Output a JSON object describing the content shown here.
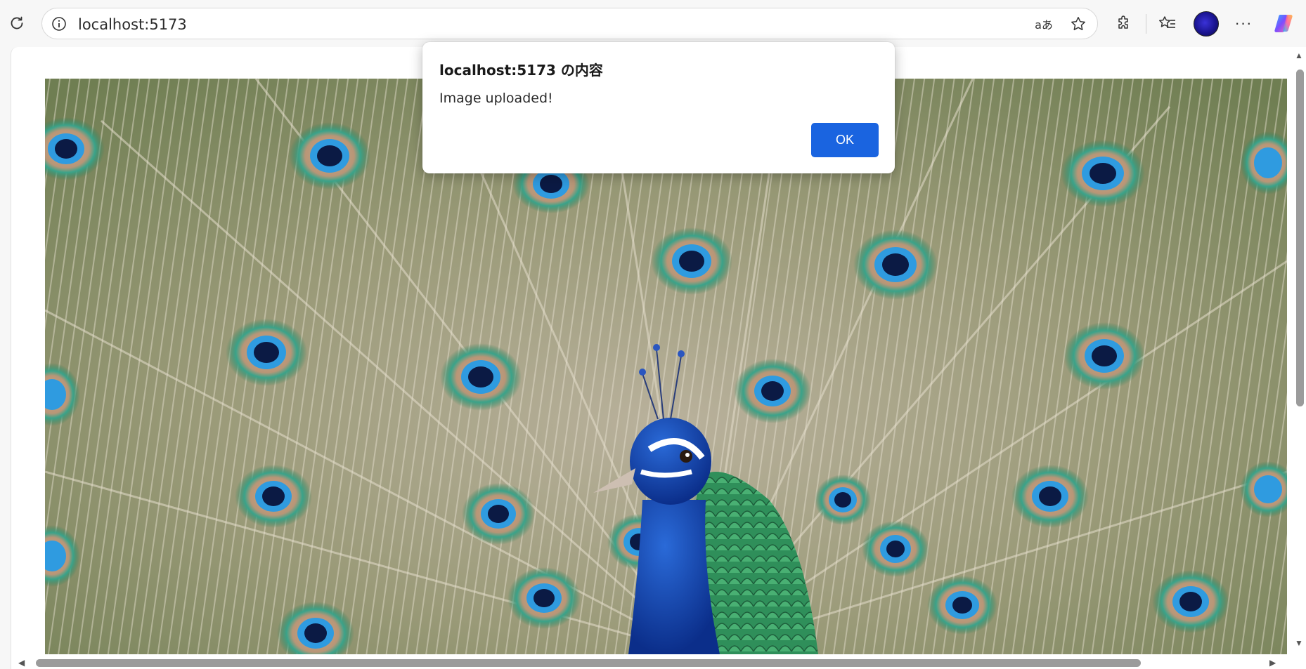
{
  "browser": {
    "url": "localhost:5173",
    "icons": {
      "reload": "reload-icon",
      "site_info": "info-icon",
      "read_aloud": "read-aloud-icon",
      "favorite": "star-icon",
      "extensions": "puzzle-icon",
      "favorites_list": "favorites-icon",
      "profile": "avatar",
      "menu": "more-icon",
      "copilot": "copilot-icon"
    }
  },
  "dialog": {
    "title": "localhost:5173 の内容",
    "message": "Image uploaded!",
    "ok_label": "OK",
    "ok_color": "#1a64e0"
  },
  "page": {
    "image_subject": "peacock"
  }
}
